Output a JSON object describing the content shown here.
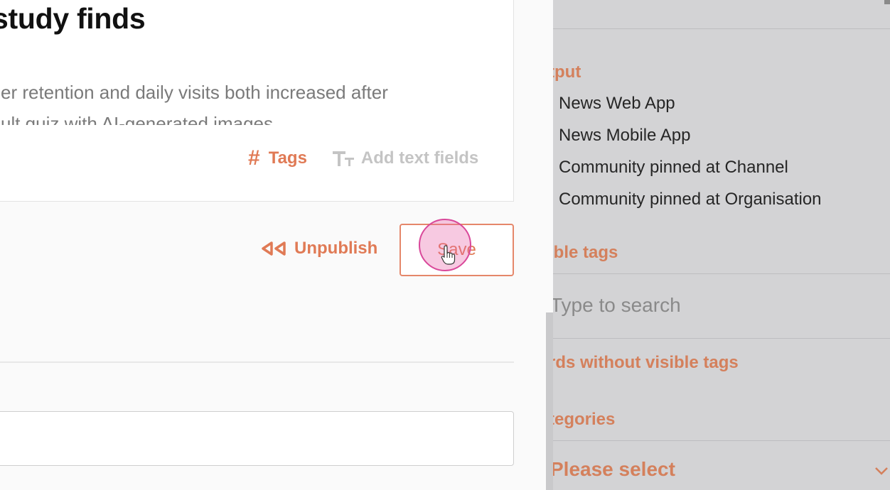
{
  "article": {
    "title": "study finds",
    "lead_lines": [
      "er retention and daily visits both increased after",
      "ult quiz with AI-generated images"
    ],
    "tags_label": "Tags",
    "add_text_label": "Add text fields"
  },
  "actions": {
    "unpublish_label": "Unpublish",
    "save_label": "Save"
  },
  "sidebar": {
    "output_heading": "tput",
    "output_items": [
      "News Web App",
      "News Mobile App",
      "Community pinned at Channel",
      "Community pinned at Organisation"
    ],
    "visible_tags_heading": "ible tags",
    "search_placeholder": "Type to search",
    "without_tags_label": "rds without visible tags",
    "categories_heading": "tegories",
    "select_placeholder": "Please select"
  },
  "colors": {
    "accent": "#e07a55",
    "sidebar_bg": "#d3d3d5",
    "click_highlight": "#d9489a"
  },
  "icons": [
    "hash-icon",
    "text-fields-icon",
    "rewind-icon",
    "chevron-down-icon",
    "hand-cursor-icon"
  ]
}
